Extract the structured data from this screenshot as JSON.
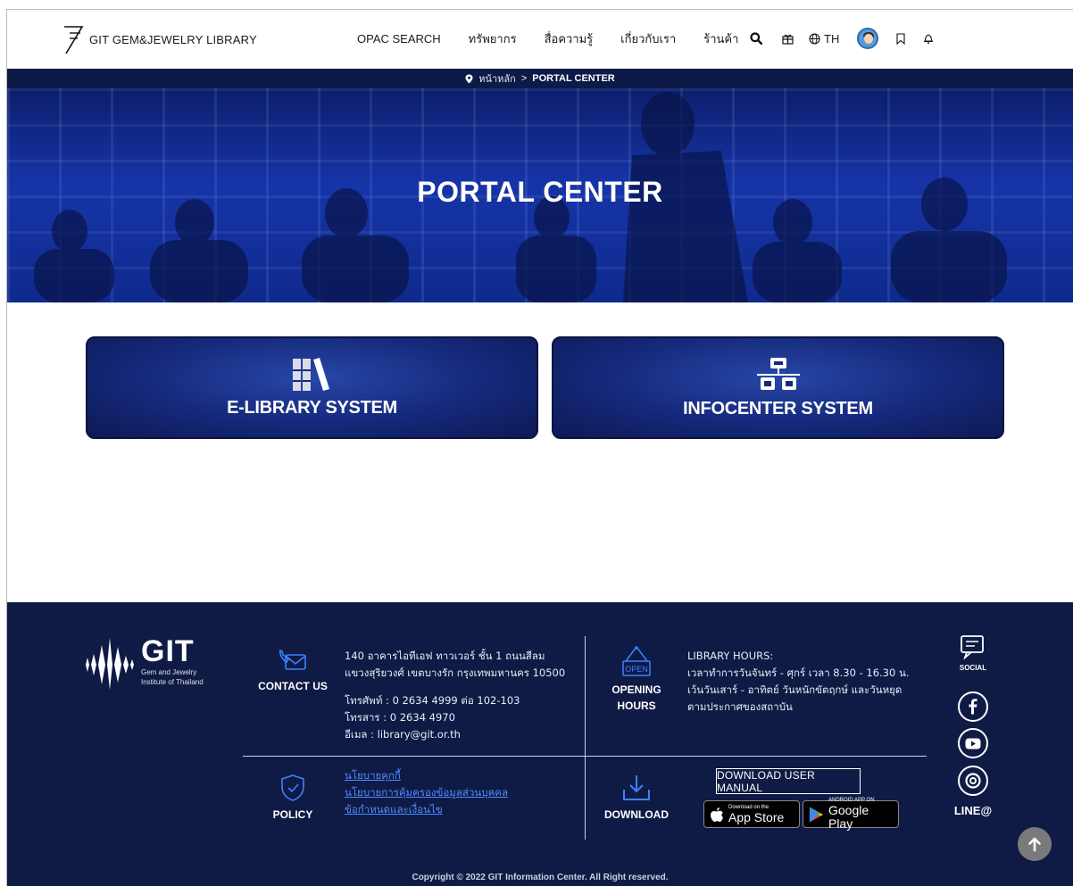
{
  "header": {
    "logo_text": "GIT GEM&JEWELRY LIBRARY",
    "nav": [
      "OPAC SEARCH",
      "ทรัพยากร",
      "สื่อความรู้",
      "เกี่ยวกับเรา",
      "ร้านค้า"
    ],
    "lang_label": "TH",
    "icons": [
      "search-icon",
      "gift-icon",
      "globe-icon",
      "avatar",
      "bookmark-icon",
      "bell-icon"
    ]
  },
  "breadcrumb": {
    "home": "หน้าหลัก",
    "separator": ">",
    "current": "PORTAL CENTER"
  },
  "hero": {
    "title": "PORTAL CENTER"
  },
  "portals": [
    {
      "label": "E-LIBRARY SYSTEM",
      "icon": "books-icon"
    },
    {
      "label": "INFOCENTER SYSTEM",
      "icon": "network-icon"
    }
  ],
  "footer": {
    "logo": {
      "word": "GIT",
      "sub1": "Gem and Jewelry",
      "sub2": "Institute of Thailand"
    },
    "contact": {
      "label": "CONTACT US",
      "address1": "140 อาคารไอทีเอฟ ทาวเวอร์ ชั้น 1 ถนนสีลม",
      "address2": "แขวงสุริยวงศ์ เขตบางรัก กรุงเทพมหานคร 10500",
      "phone": "โทรศัพท์ : 0 2634 4999 ต่อ 102-103",
      "fax": "โทรสาร : 0 2634 4970",
      "email": "อีเมล : library@git.or.th"
    },
    "hours": {
      "label1": "OPENING",
      "label2": "HOURS",
      "sign": "OPEN",
      "title": "LIBRARY HOURS:",
      "line1": "เวลาทำการวันจันทร์ - ศุกร์ เวลา 8.30 - 16.30 น.",
      "line2": "เว้นวันเสาร์ - อาทิตย์ วันหนักขัตฤกษ์ และวันหยุด",
      "line3": "ตามประกาศของสถาบัน"
    },
    "policy": {
      "label": "POLICY",
      "links": [
        "นโยบายคุกกี้",
        "นโยบายการคุ้มครองข้อมูลส่วนบุคคล",
        "ข้อกำหนดและเงื่อนไข"
      ]
    },
    "download": {
      "label": "DOWNLOAD",
      "manual": "DOWNLOAD USER MANUAL",
      "appstore_small": "Download on the",
      "appstore_big": "App Store",
      "play_small": "ANDROID APP ON",
      "play_big": "Google Play"
    },
    "social": {
      "label": "SOCIAL",
      "line_label": "LINE@"
    },
    "copyright": "Copyright © 2022 GIT Information Center. All Right reserved."
  },
  "colors": {
    "nav_bg": "#0d1a47",
    "footer_bg": "#0f1b45",
    "link": "#4f8bff",
    "card_blue": "#15287a"
  }
}
